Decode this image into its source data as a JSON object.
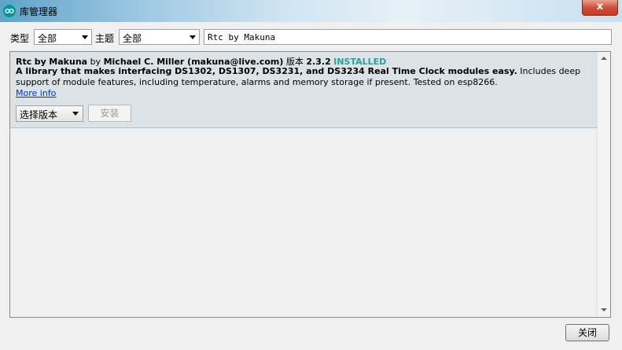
{
  "window": {
    "title": "库管理器",
    "close_symbol": "x",
    "icon": "arduino-logo-icon"
  },
  "filters": {
    "type_label": "类型",
    "type_value": "全部",
    "topic_label": "主题",
    "topic_value": "全部",
    "search_value": "Rtc by Makuna"
  },
  "library": {
    "name": "Rtc",
    "by_word": "by",
    "author": "Makuna",
    "by_word2": "by",
    "maintainer": "Michael C. Miller (makuna@live.com)",
    "version_label": "版本",
    "version": "2.3.2",
    "status": "INSTALLED",
    "summary": "A library that makes interfacing DS1302, DS1307, DS3231, and DS3234 Real Time Clock modules easy.",
    "description": "Includes deep support of module features, including temperature, alarms and memory storage if present. Tested on esp8266.",
    "more_info": "More info",
    "version_select": "选择版本",
    "install_label": "安装"
  },
  "footer": {
    "close_label": "关闭"
  },
  "colors": {
    "installed": "#2aa198",
    "item_bg": "#dbe3e6",
    "link": "#0033cc",
    "close_button": "#cc4b33"
  }
}
